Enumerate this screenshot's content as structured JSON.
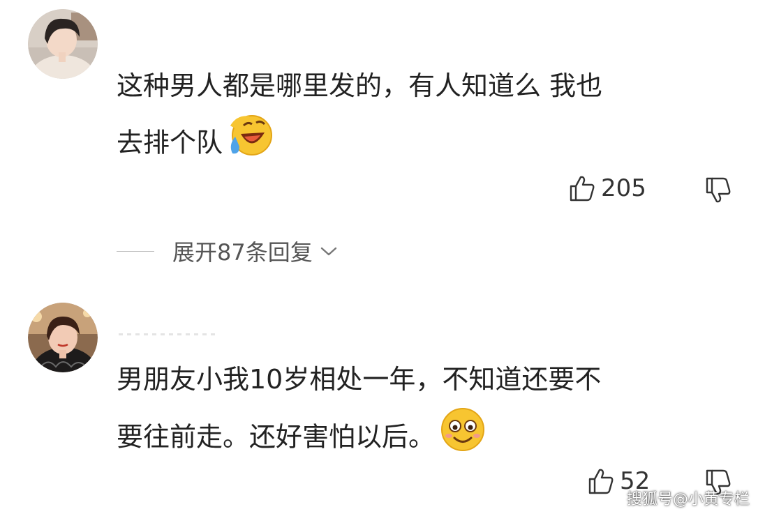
{
  "comments": [
    {
      "avatar_icon": "user-avatar-icon",
      "text_lines": [
        "这种男人都是哪里发的，有人知道么 我也",
        "去排个队"
      ],
      "emoji": "laugh-cry-emoji-icon",
      "likes": "205",
      "replies_label": "展开87条回复"
    },
    {
      "avatar_icon": "user-avatar-icon",
      "text_lines": [
        "男朋友小我10岁相处一年，不知道还要不",
        "要往前走。还好害怕以后。"
      ],
      "emoji": "smile-emoji-icon",
      "likes": "52"
    }
  ],
  "watermark": "搜狐号@小黄专栏",
  "colors": {
    "text": "#222222",
    "secondary": "#555555",
    "icon": "#333333"
  }
}
